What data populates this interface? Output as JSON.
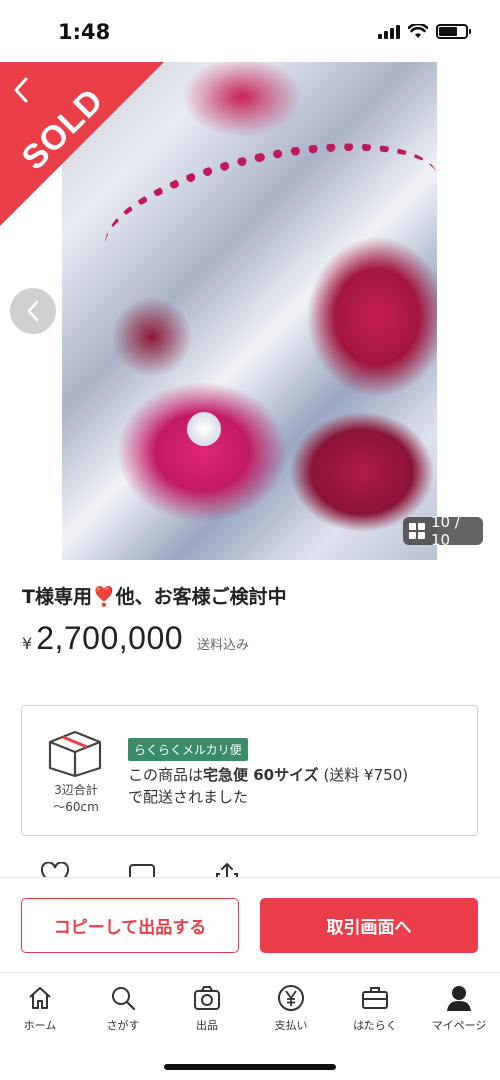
{
  "status_bar": {
    "time": "1:48"
  },
  "gallery": {
    "sold_label": "SOLD",
    "counter": "10 / 10"
  },
  "item": {
    "title": "T様専用❣️他、お客様ご検討中",
    "currency_symbol": "¥",
    "price": "2,700,000",
    "shipping_included": "送料込み"
  },
  "shipping": {
    "size_label_line1": "3辺合計",
    "size_label_line2": "〜60cm",
    "badge": "らくらくメルカリ便",
    "desc_prefix": "この商品は",
    "desc_method": "宅急便 60サイズ",
    "desc_fee": " (送料 ¥750)",
    "desc_suffix": "で配送されました"
  },
  "buttons": {
    "copy_listing": "コピーして出品する",
    "go_to_transaction": "取引画面へ"
  },
  "tabbar": {
    "items": [
      {
        "label": "ホーム",
        "icon": "home-icon"
      },
      {
        "label": "さがす",
        "icon": "search-icon"
      },
      {
        "label": "出品",
        "icon": "camera-icon"
      },
      {
        "label": "支払い",
        "icon": "yen-icon"
      },
      {
        "label": "はたらく",
        "icon": "briefcase-icon"
      },
      {
        "label": "マイページ",
        "icon": "person-icon"
      }
    ]
  },
  "colors": {
    "accent": "#ea3f4a",
    "rakuraku_green": "#3a8c68"
  }
}
